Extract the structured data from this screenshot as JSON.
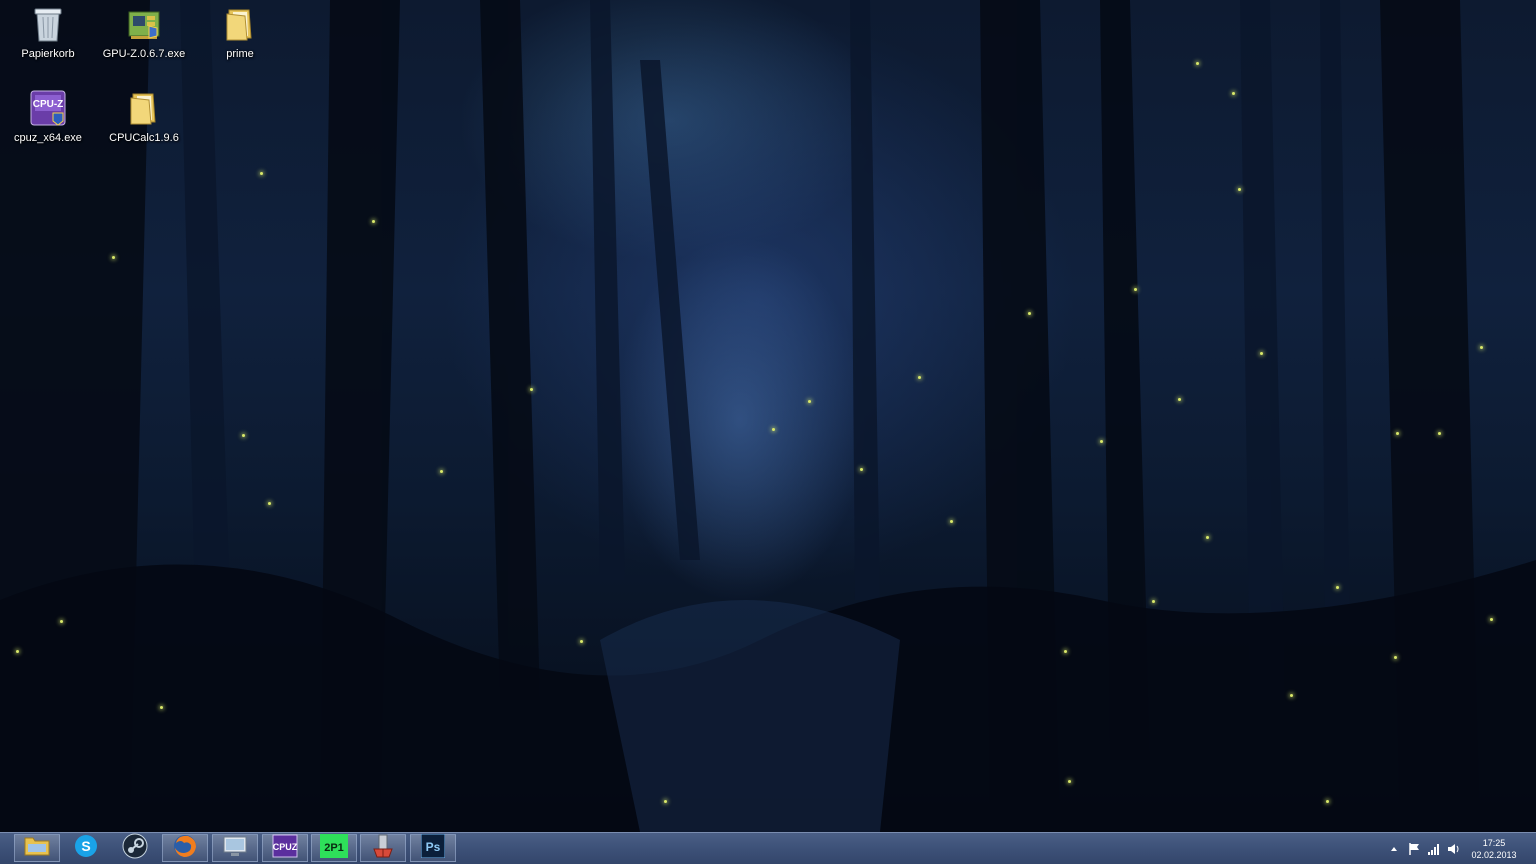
{
  "desktop": {
    "icons": [
      {
        "label": "Papierkorb",
        "icon": "recycle-bin-icon"
      },
      {
        "label": "GPU-Z.0.6.7.exe",
        "icon": "gpu-z-icon"
      },
      {
        "label": "prime",
        "icon": "folder-icon"
      },
      {
        "label": "cpuz_x64.exe",
        "icon": "cpu-z-icon"
      },
      {
        "label": "CPUCalc1.9.6",
        "icon": "folder-icon"
      }
    ],
    "cpuz_badge": "CPU-Z"
  },
  "taskbar": {
    "pinned": [
      {
        "name": "file-explorer",
        "icon": "folder-icon"
      },
      {
        "name": "skype",
        "icon": "skype-icon",
        "glyph": "S"
      },
      {
        "name": "steam",
        "icon": "steam-icon"
      },
      {
        "name": "firefox",
        "icon": "firefox-icon"
      },
      {
        "name": "remote-desktop",
        "icon": "monitor-icon"
      },
      {
        "name": "cpu-z",
        "icon": "cpu-z-icon",
        "glyph": "CPUZ"
      },
      {
        "name": "2p1-app",
        "icon": "2p1-icon",
        "glyph": "2P1"
      },
      {
        "name": "sound-tool",
        "icon": "sound-tool-icon"
      },
      {
        "name": "photoshop",
        "icon": "photoshop-icon",
        "glyph": "Ps"
      }
    ],
    "tray": {
      "icons": [
        "show-hidden-icons-icon",
        "flag-icon",
        "network-icon",
        "volume-icon"
      ],
      "time": "17:25",
      "date": "02.02.2013"
    }
  },
  "colors": {
    "taskbar": "#3d5178",
    "wallpaper_base": "#10213d",
    "firefly": "#d9e86a"
  }
}
